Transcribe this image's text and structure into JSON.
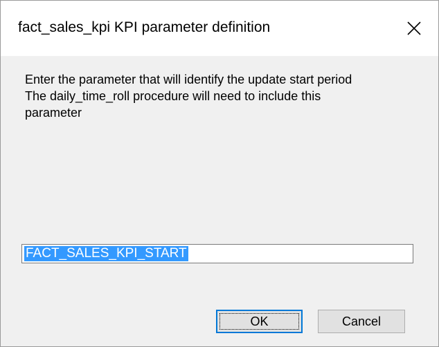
{
  "window": {
    "title": "fact_sales_kpi KPI parameter definition",
    "close_icon": "close-icon"
  },
  "message": {
    "lines": [
      "Enter the parameter that will identify the update start period",
      "The daily_time_roll procedure will need to include this",
      "parameter"
    ]
  },
  "parameter_field": {
    "value": "FACT_SALES_KPI_START",
    "selected": true
  },
  "buttons": {
    "ok_label": "OK",
    "cancel_label": "Cancel"
  },
  "colors": {
    "selection_background": "#3399ff",
    "default_button_border": "#0078d7",
    "dialog_background": "#f0f0f0"
  }
}
